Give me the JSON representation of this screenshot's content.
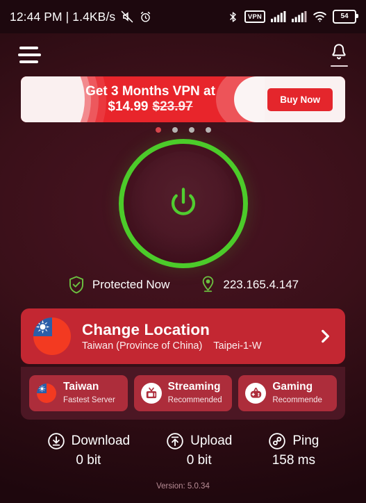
{
  "statusbar": {
    "clock": "12:44 PM | 1.4KB/s",
    "icons_left": [
      "mute-icon",
      "alarm-icon"
    ],
    "icons_right": [
      "bluetooth-icon",
      "vpn-icon",
      "signal-icon",
      "signal-icon",
      "wifi-icon",
      "battery-icon"
    ],
    "vpn_label": "VPN",
    "battery_level": "54"
  },
  "appbar": {
    "menu_icon": "hamburger-menu-icon",
    "notification_icon": "bell-icon"
  },
  "banner": {
    "line1": "Get 3 Months VPN at",
    "price": "$14.99",
    "old_price": "$23.97",
    "cta": "Buy Now"
  },
  "carousel": {
    "count": 4,
    "active_index": 0
  },
  "power": {
    "icon": "power-icon",
    "state": "on",
    "ring_color": "#4ccb2a"
  },
  "connection": {
    "status_label": "Protected Now",
    "status_icon": "shield-check-icon",
    "ip_address": "223.165.4.147",
    "ip_icon": "location-pin-icon"
  },
  "location_card": {
    "title": "Change Location",
    "country": "Taiwan (Province of China)",
    "server": "Taipei-1-W",
    "flag": "taiwan-flag-icon",
    "chevron": "chevron-right-icon"
  },
  "quick_chips": [
    {
      "title": "Taiwan",
      "subtitle": "Fastest Server",
      "icon": "taiwan-flag-icon"
    },
    {
      "title": "Streaming",
      "subtitle": "Recommended",
      "icon": "tv-icon"
    },
    {
      "title": "Gaming",
      "subtitle": "Recommende",
      "icon": "gamepad-icon"
    }
  ],
  "stats": [
    {
      "label": "Download",
      "value": "0 bit",
      "icon": "download-icon"
    },
    {
      "label": "Upload",
      "value": "0 bit",
      "icon": "upload-icon"
    },
    {
      "label": "Ping",
      "value": "158 ms",
      "icon": "ping-icon"
    }
  ],
  "footer": {
    "version": "Version: 5.0.34"
  },
  "colors": {
    "background": "#3a1019",
    "accent_red": "#c32732",
    "banner_red": "#e8252b",
    "green": "#4ccb2a"
  }
}
